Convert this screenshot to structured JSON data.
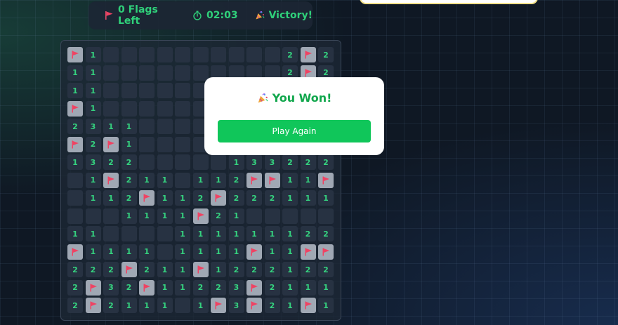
{
  "status": {
    "flags_text": "0 Flags Left",
    "time_text": "02:03",
    "result_text": "Victory!"
  },
  "icons": {
    "flag": "flag-icon",
    "timer": "stopwatch-icon",
    "party": "party-popper-icon"
  },
  "colors": {
    "number": "#35d27f",
    "flag": "#ef4363",
    "cell_hidden": "#273242",
    "cell_flagged": "#a0a8b4",
    "play_button": "#10c65a",
    "modal_title": "#12a74d"
  },
  "board": {
    "rows": [
      [
        "F",
        "1",
        "",
        "",
        "",
        "",
        "",
        "",
        "",
        "",
        "",
        "",
        "2",
        "F",
        "2"
      ],
      [
        "1",
        "1",
        "",
        "",
        "",
        "",
        "",
        "",
        "",
        "",
        "",
        "",
        "2",
        "F",
        "2"
      ],
      [
        "1",
        "1",
        "",
        "",
        "",
        "",
        "",
        "",
        "",
        "",
        "",
        "",
        "",
        "",
        ""
      ],
      [
        "F",
        "1",
        "",
        "",
        "",
        "",
        "",
        "",
        "",
        "",
        "",
        "",
        "",
        "",
        ""
      ],
      [
        "2",
        "3",
        "1",
        "1",
        "",
        "",
        "",
        "",
        "",
        "",
        "",
        "",
        "",
        "",
        ""
      ],
      [
        "F",
        "2",
        "F",
        "1",
        "",
        "",
        "",
        "",
        "",
        "",
        "",
        "",
        "",
        "",
        ""
      ],
      [
        "1",
        "3",
        "2",
        "2",
        "",
        "",
        "",
        "",
        "",
        "1",
        "3",
        "3",
        "2",
        "2",
        "2"
      ],
      [
        "",
        "1",
        "F",
        "2",
        "1",
        "1",
        "",
        "1",
        "1",
        "2",
        "F",
        "F",
        "1",
        "1",
        "F"
      ],
      [
        "",
        "1",
        "1",
        "2",
        "F",
        "1",
        "1",
        "2",
        "F",
        "2",
        "2",
        "2",
        "1",
        "1",
        "1"
      ],
      [
        "",
        "",
        "",
        "1",
        "1",
        "1",
        "1",
        "F",
        "2",
        "1",
        "",
        "",
        "",
        "",
        ""
      ],
      [
        "1",
        "1",
        "",
        "",
        "",
        "",
        "1",
        "1",
        "1",
        "1",
        "1",
        "1",
        "1",
        "2",
        "2"
      ],
      [
        "F",
        "1",
        "1",
        "1",
        "1",
        "",
        "1",
        "1",
        "1",
        "1",
        "F",
        "1",
        "1",
        "F",
        "F"
      ],
      [
        "2",
        "2",
        "2",
        "F",
        "2",
        "1",
        "1",
        "F",
        "1",
        "2",
        "2",
        "2",
        "1",
        "2",
        "2"
      ],
      [
        "2",
        "F",
        "3",
        "2",
        "F",
        "1",
        "1",
        "2",
        "2",
        "3",
        "F",
        "2",
        "1",
        "1",
        "1"
      ],
      [
        "2",
        "F",
        "2",
        "1",
        "1",
        "1",
        "",
        "1",
        "F",
        "3",
        "F",
        "2",
        "1",
        "F",
        "1"
      ]
    ]
  },
  "modal": {
    "title": "You Won!",
    "button_label": "Play Again"
  }
}
